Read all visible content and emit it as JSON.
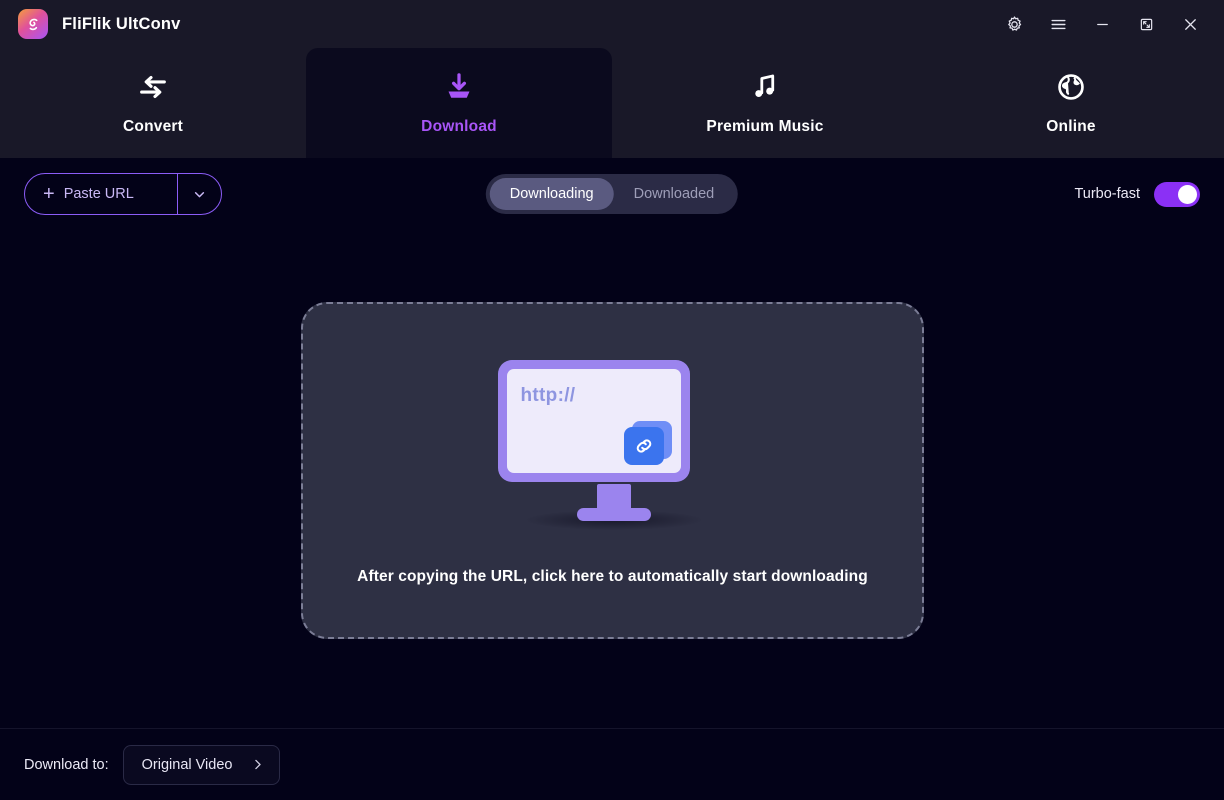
{
  "app": {
    "title": "FliFlik UltConv",
    "logo_icon": "fliflik-logo-icon",
    "accent_color": "#a855f7",
    "toggle_color": "#8b30f5",
    "background_color": "#030218",
    "header_color": "#191828"
  },
  "window_controls": [
    {
      "name": "settings",
      "icon": "gear-icon"
    },
    {
      "name": "menu",
      "icon": "hamburger-menu-icon"
    },
    {
      "name": "minimize",
      "icon": "minimize-icon"
    },
    {
      "name": "maximize",
      "icon": "restore-window-icon"
    },
    {
      "name": "close",
      "icon": "close-icon"
    }
  ],
  "tabs": [
    {
      "label": "Convert",
      "icon": "convert-arrows-icon",
      "active": false
    },
    {
      "label": "Download",
      "icon": "download-arrow-icon",
      "active": true
    },
    {
      "label": "Premium Music",
      "icon": "music-note-icon",
      "active": false
    },
    {
      "label": "Online",
      "icon": "globe-icon",
      "active": false
    }
  ],
  "toolbar": {
    "paste_url_label": "Paste URL",
    "paste_url_plus": "+",
    "paste_url_caret_icon": "chevron-down-icon",
    "segments": [
      {
        "label": "Downloading",
        "active": true
      },
      {
        "label": "Downloaded",
        "active": false
      }
    ],
    "turbo_label": "Turbo-fast",
    "turbo_enabled": true
  },
  "dropzone": {
    "hint": "After copying the URL, click here to automatically start downloading",
    "screen_text": "http://",
    "link_icon": "chain-link-icon",
    "monitor_icon": "monitor-illustration"
  },
  "bottom": {
    "label": "Download to:",
    "destination": "Original Video",
    "destination_caret_icon": "chevron-right-icon"
  }
}
